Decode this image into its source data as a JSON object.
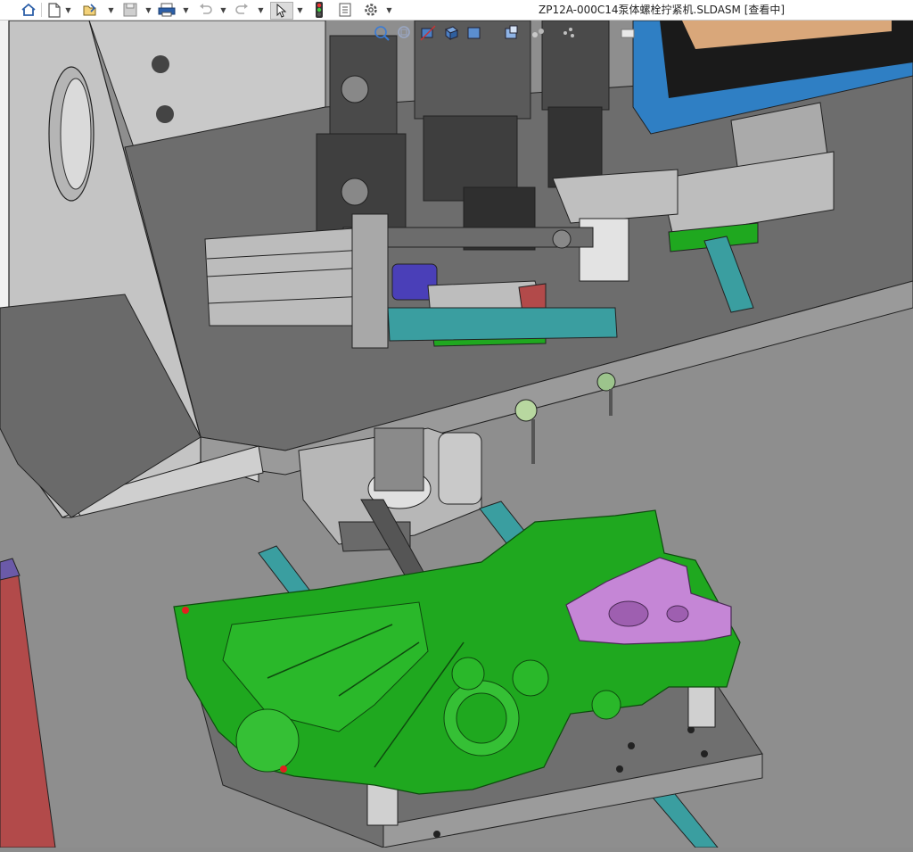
{
  "window": {
    "title": "ZP12A-000C14泵体螺栓拧紧机.SLDASM [查看中]"
  },
  "toolbar": {
    "items": [
      {
        "name": "home-icon"
      },
      {
        "name": "new-document-icon"
      },
      {
        "name": "open-icon"
      },
      {
        "name": "save-icon"
      },
      {
        "name": "print-icon"
      },
      {
        "name": "undo-icon"
      },
      {
        "name": "redo-icon"
      },
      {
        "name": "select-pointer-icon"
      },
      {
        "name": "rebuild-traffic-light-icon"
      },
      {
        "name": "file-properties-icon"
      },
      {
        "name": "options-gear-icon"
      }
    ]
  },
  "heads_up_view_toolbar": {
    "items": [
      {
        "name": "zoom-to-fit-icon"
      },
      {
        "name": "zoom-area-icon"
      },
      {
        "name": "section-view-icon"
      },
      {
        "name": "view-orientation-icon"
      },
      {
        "name": "display-style-icon"
      },
      {
        "name": "hide-show-items-icon"
      },
      {
        "name": "edit-appearance-icon"
      },
      {
        "name": "apply-scene-icon"
      },
      {
        "name": "view-settings-icon"
      }
    ]
  },
  "colors": {
    "background": "#8c8c8c",
    "frame_gray": "#bdbdbd",
    "plate_gray": "#6e6e6e",
    "part_green": "#1fa81f",
    "part_purple": "#c586d6",
    "rail_teal": "#3a9ea0",
    "monitor_blue": "#2f7fc4",
    "monitor_screen": "#1a1a1a",
    "monitor_tan": "#d9a77a",
    "red_column": "#b04a4a"
  }
}
